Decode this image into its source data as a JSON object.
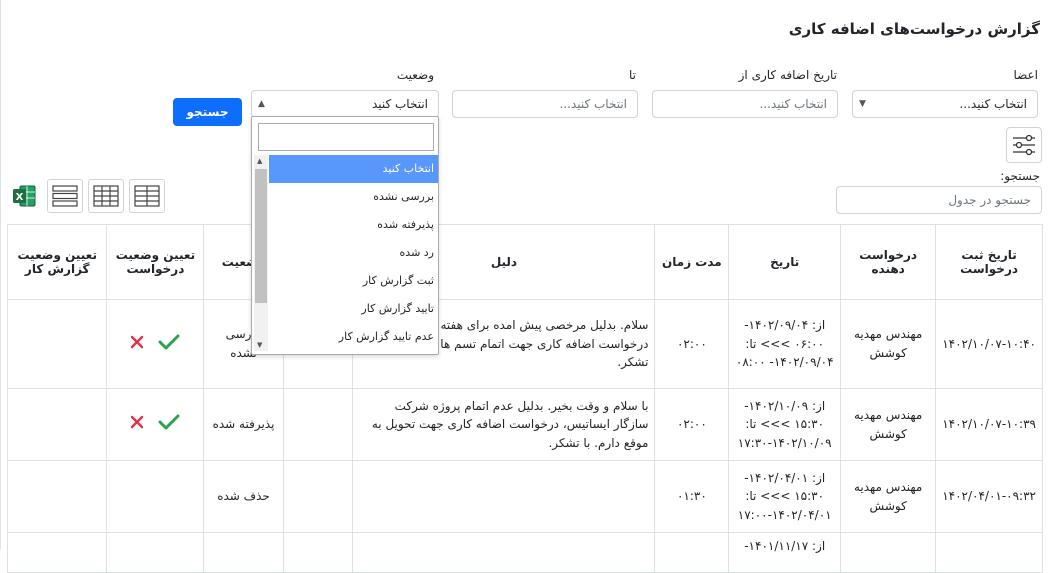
{
  "page": {
    "title": "گزارش درخواست‌های اضافه کاری"
  },
  "filters": {
    "members_label": "اعضا",
    "members_value": "انتخاب کنید...",
    "from_label": "تاریخ اضافه کاری از",
    "from_placeholder": "انتخاب کنید...",
    "to_label": "تا",
    "to_placeholder": "انتخاب کنید...",
    "status_label": "وضعیت",
    "status_value": "انتخاب کنید",
    "search_button": "جستجو"
  },
  "status_dropdown": {
    "options": [
      "انتخاب کنید",
      "بررسی نشده",
      "پذیرفته شده",
      "رد شده",
      "ثبت گزارش کار",
      "تایید گزارش کار",
      "عدم تایید گزارش کار"
    ],
    "selected_index": 0
  },
  "table_search": {
    "label": "جستجو:",
    "placeholder": "جستجو در جدول"
  },
  "table": {
    "headers": [
      "تاریخ ثبت درخواست",
      "درخواست دهنده",
      "تاریخ",
      "مدت زمان",
      "دلیل",
      "",
      "وضعیت",
      "تعیین وضعیت درخواست",
      "تعیین وضعیت گزارش کار"
    ],
    "rows": [
      {
        "submitted": "۱۴۰۲/۱۰/۰۷-۱۰:۴۰",
        "requester": "مهندس مهدیه کوشش",
        "date": "از: ۱۴۰۲/۰۹/۰۴- ۰۶:۰۰ >>> تا: ۱۴۰۲/۰۹/۰۴- ۰۸:۰۰",
        "duration": "۰۲:۰۰",
        "reason": "سلام. بدلیل مرخصی پیش امده برای هفته جاری درخواست اضافه کاری جهت اتمام تسم ها را دارم. با تشکر.",
        "extra": "",
        "status": "بررسی نشده",
        "has_actions": true
      },
      {
        "submitted": "۱۴۰۲/۱۰/۰۷-۱۰:۳۹",
        "requester": "مهندس مهدیه کوشش",
        "date": "از: ۱۴۰۲/۱۰/۰۹- ۱۵:۳۰ >>> تا: ۱۴۰۲/۱۰/۰۹-۱۷:۳۰",
        "duration": "۰۲:۰۰",
        "reason": "با سلام و وقت بخیر. بدلیل عدم اتمام پروژه شرکت سازگار ایساتیس، درخواست اضافه کاری جهت تحویل به موقع دارم. با تشکر.",
        "extra": "",
        "status": "پذیرفته شده",
        "has_actions": true
      },
      {
        "submitted": "۱۴۰۲/۰۴/۰۱-۰۹:۳۲",
        "requester": "مهندس مهدیه کوشش",
        "date": "از: ۱۴۰۲/۰۴/۰۱- ۱۵:۳۰ >>> تا: ۱۴۰۲/۰۴/۰۱-۱۷:۰۰",
        "duration": "۰۱:۳۰",
        "reason": "",
        "extra": "",
        "status": "حذف شده",
        "has_actions": false
      },
      {
        "submitted": "",
        "requester": "",
        "date": "از: ۱۴۰۱/۱۱/۱۷-",
        "duration": "",
        "reason": "",
        "extra": "",
        "status": "",
        "has_actions": false
      }
    ]
  },
  "colors": {
    "primary": "#0d6efd",
    "approve": "#28a745",
    "reject": "#dc3545",
    "excel": "#1d6f42",
    "dropdown_active": "#5897fb"
  }
}
